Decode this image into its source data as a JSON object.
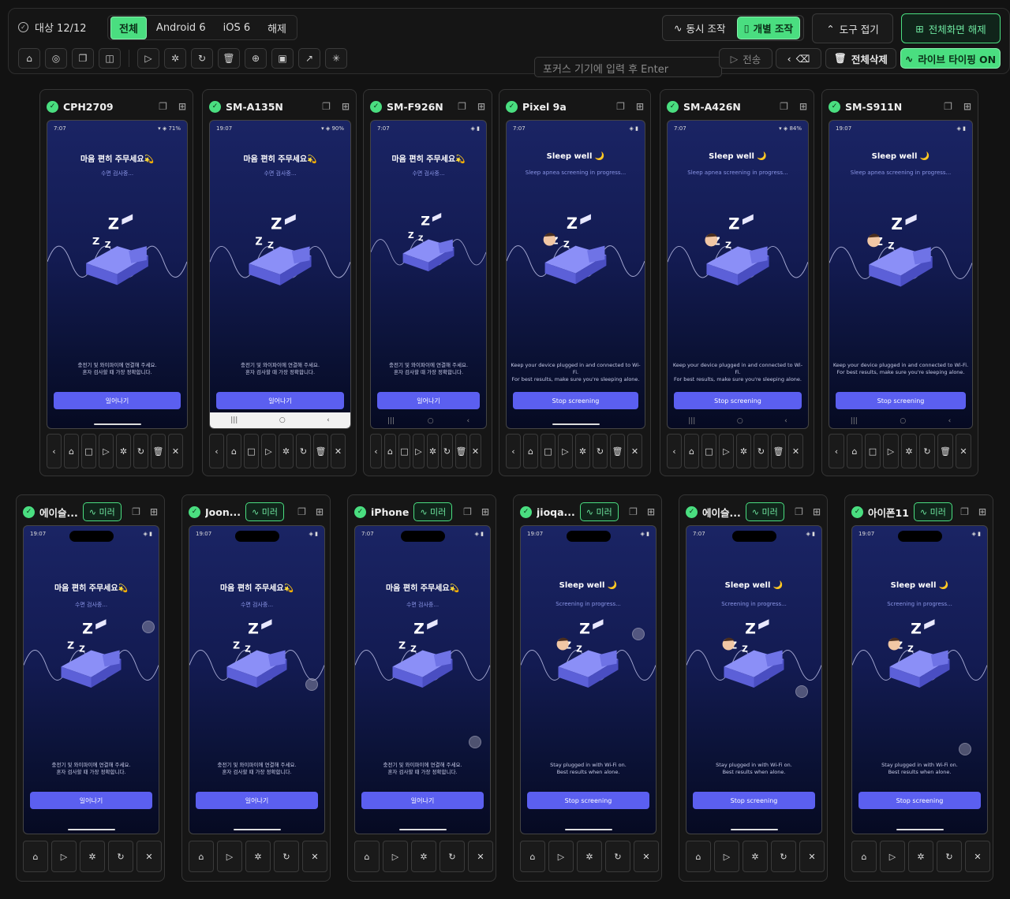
{
  "toolbar": {
    "target_label": "대상 12/12",
    "filters": [
      "전체",
      "Android 6",
      "iOS 6",
      "해제"
    ],
    "filter_active": 0,
    "icons": [
      "home-icon",
      "check-circle-icon",
      "copy-icon",
      "camera-icon",
      "play-icon",
      "bug-icon",
      "refresh-icon",
      "trash-icon",
      "globe-icon",
      "image-icon",
      "magic-icon",
      "sparkle-icon"
    ],
    "sync_label": "동시 조작",
    "individual_label": "개별 조작",
    "collapse_label": "도구 접기",
    "fullscreen_exit_label": "전체화면 해제",
    "input_placeholder": "포커스 기기에 입력 후 Enter",
    "send_label": "전송",
    "delete_all_label": "전체삭제",
    "live_typing_label": "라이브 타이핑 ON",
    "accent": "#4ade80"
  },
  "mirror_label": "미러",
  "android_devices": [
    {
      "name": "CPH2709",
      "time": "7:07",
      "status": "71%",
      "lang": "ko",
      "title": "마음 편히 주무세요💫",
      "sub": "수면 검사중...",
      "note1": "충전기 및 와이파이에 연결해 주세요.",
      "note2": "혼자 검사할 때 가장 정확합니다.",
      "cta": "일어나기",
      "nav": "gesture"
    },
    {
      "name": "SM-A135N",
      "time": "19:07",
      "status": "90%",
      "lang": "ko",
      "title": "마음 편히 주무세요💫",
      "sub": "수면 검사중...",
      "note1": "충전기 및 와이파이에 연결해 주세요.",
      "note2": "혼자 검사할 때 가장 정확합니다.",
      "cta": "일어나기",
      "nav": "buttons-light"
    },
    {
      "name": "SM-F926N",
      "time": "7:07",
      "status": "",
      "lang": "ko",
      "title": "마음 편히 주무세요💫",
      "sub": "수면 검사중...",
      "note1": "충전기 및 와이파이에 연결해 주세요.",
      "note2": "혼자 검사할 때 가장 정확합니다.",
      "cta": "일어나기",
      "nav": "buttons"
    },
    {
      "name": "Pixel 9a",
      "time": "7:07",
      "status": "",
      "lang": "en",
      "title": "Sleep well 🌙",
      "sub": "Sleep apnea screening in progress...",
      "note1": "Keep your device plugged in and connected to Wi-Fi.",
      "note2": "For best results, make sure you're sleeping alone.",
      "cta": "Stop screening",
      "nav": "gesture"
    },
    {
      "name": "SM-A426N",
      "time": "7:07",
      "status": "84%",
      "lang": "en",
      "title": "Sleep well 🌙",
      "sub": "Sleep apnea screening in progress...",
      "note1": "Keep your device plugged in and connected to Wi-Fi.",
      "note2": "For best results, make sure you're sleeping alone.",
      "cta": "Stop screening",
      "nav": "buttons"
    },
    {
      "name": "SM-S911N",
      "time": "19:07",
      "status": "",
      "lang": "en",
      "title": "Sleep well 🌙",
      "sub": "Sleep apnea screening in progress...",
      "note1": "Keep your device plugged in and connected to Wi-Fi.",
      "note2": "For best results, make sure you're sleeping alone.",
      "cta": "Stop screening",
      "nav": "buttons"
    }
  ],
  "ios_devices": [
    {
      "name": "에이슬...",
      "time": "19:07",
      "lang": "ko",
      "title": "마음 편히 주무세요💫",
      "sub": "수면 검사중...",
      "note1": "충전기 및 와이파이에 연결해 주세요.",
      "note2": "혼자 검사할 때 가장 정확합니다.",
      "cta": "일어나기"
    },
    {
      "name": "Joon...",
      "time": "19:07",
      "lang": "ko",
      "title": "마음 편히 주무세요💫",
      "sub": "수면 검사중...",
      "note1": "충전기 및 와이파이에 연결해 주세요.",
      "note2": "혼자 검사할 때 가장 정확합니다.",
      "cta": "일어나기"
    },
    {
      "name": "iPhone",
      "time": "7:07",
      "lang": "ko",
      "title": "마음 편히 주무세요💫",
      "sub": "수면 검사중...",
      "note1": "충전기 및 와이파이에 연결해 주세요.",
      "note2": "혼자 검사할 때 가장 정확합니다.",
      "cta": "일어나기"
    },
    {
      "name": "jioqa...",
      "time": "19:07",
      "lang": "en",
      "title": "Sleep well 🌙",
      "sub": "Screening in progress...",
      "note1": "Stay plugged in with Wi-Fi on.",
      "note2": "Best results when alone.",
      "cta": "Stop screening"
    },
    {
      "name": "에이슬...",
      "time": "7:07",
      "lang": "en",
      "title": "Sleep well 🌙",
      "sub": "Screening in progress...",
      "note1": "Stay plugged in with Wi-Fi on.",
      "note2": "Best results when alone.",
      "cta": "Stop screening"
    },
    {
      "name": "아이폰11",
      "time": "19:07",
      "lang": "en",
      "title": "Sleep well 🌙",
      "sub": "Screening in progress...",
      "note1": "Stay plugged in with Wi-Fi on.",
      "note2": "Best results when alone.",
      "cta": "Stop screening"
    }
  ],
  "android_controls": [
    "back-icon",
    "home-icon",
    "square-icon",
    "play-icon",
    "bug-icon",
    "refresh-icon",
    "trash-icon",
    "close-icon"
  ],
  "ios_controls": [
    "home-icon",
    "play-icon",
    "bug-icon",
    "refresh-icon",
    "close-icon"
  ]
}
